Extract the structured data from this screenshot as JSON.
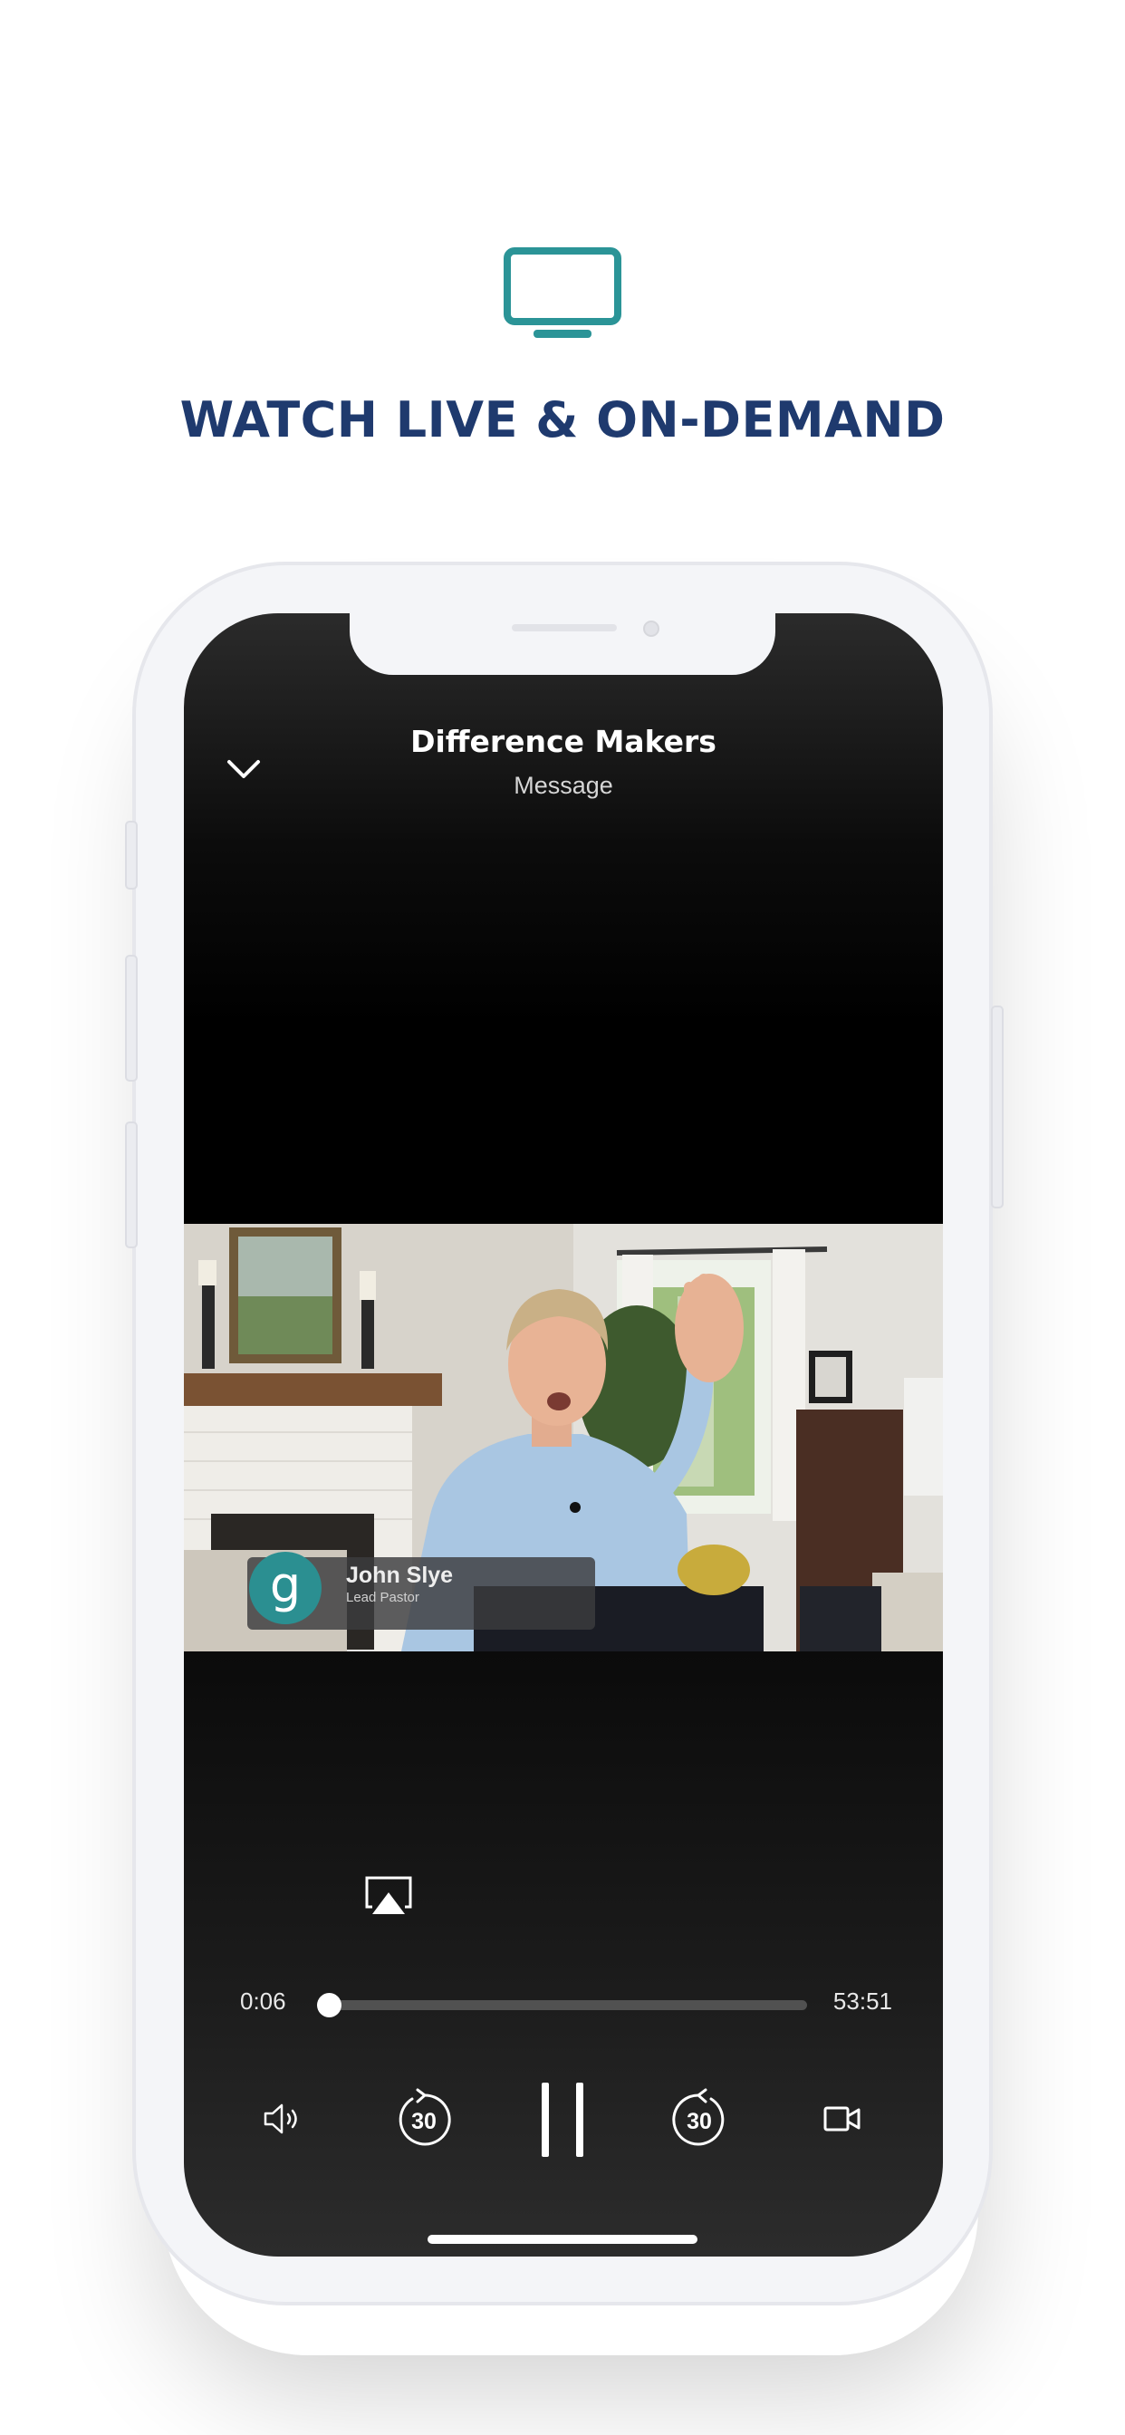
{
  "promo": {
    "icon": "tv-icon",
    "headline": "WATCH LIVE & ON-DEMAND",
    "accent_color": "#2b9497",
    "headline_color": "#1f3a6e"
  },
  "player": {
    "title": "Difference Makers",
    "subtitle": "Message",
    "lower_third": {
      "badge_letter": "g",
      "name": "John Slye",
      "role": "Lead Pastor"
    },
    "current_time": "0:06",
    "duration": "53:51",
    "progress_fraction": 0.002,
    "skip_back_seconds": "30",
    "skip_forward_seconds": "30",
    "state": "playing",
    "icons": {
      "collapse": "chevron-down-icon",
      "airplay": "airplay-icon",
      "volume": "volume-icon",
      "rewind": "rewind-30-icon",
      "pause": "pause-icon",
      "forward": "forward-30-icon",
      "video_mode": "video-camera-icon"
    }
  }
}
